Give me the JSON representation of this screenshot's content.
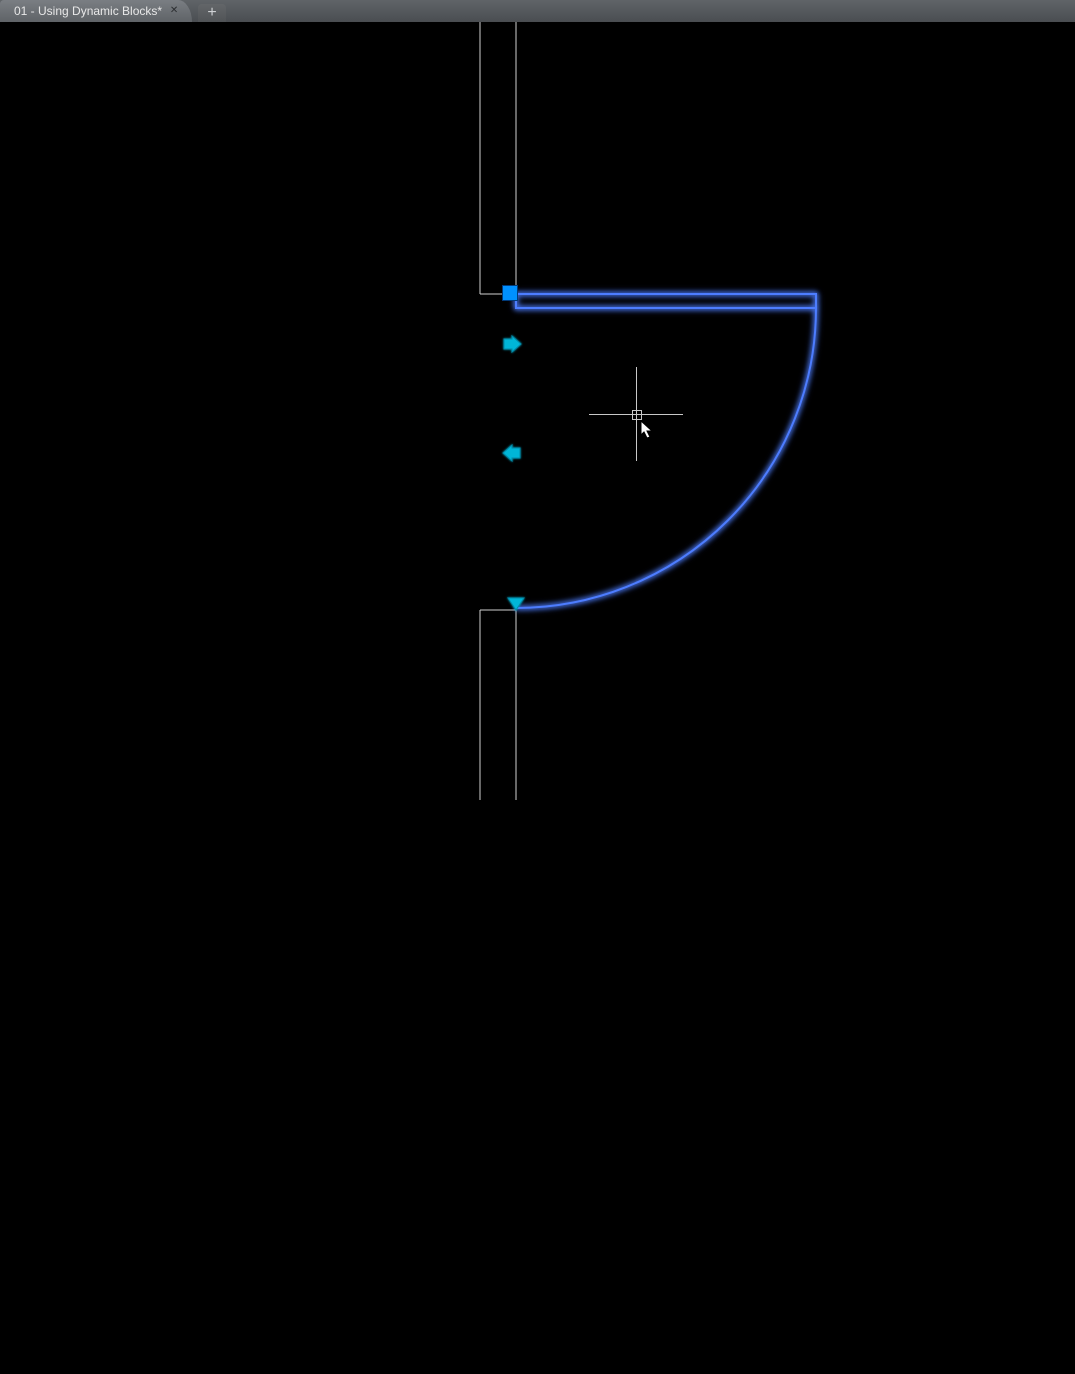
{
  "tabs": {
    "active": {
      "label": "01 - Using Dynamic Blocks*"
    },
    "new_tab_icon": "plus-icon",
    "close_icon": "close-icon"
  },
  "block": {
    "name": "door-dynamic-block",
    "selected": true,
    "grips": {
      "base": {
        "icon": "base-grip",
        "type": "insertion"
      },
      "flip_h": {
        "icon": "arrow-right-grip",
        "type": "flip"
      },
      "lookup": {
        "icon": "arrow-left-grip",
        "type": "lookup"
      },
      "stretch": {
        "icon": "triangle-down-grip",
        "type": "linear"
      }
    }
  },
  "cursor": {
    "icon": "crosshair-cursor"
  },
  "colors": {
    "selection_glow": "#4d7dff",
    "grip_primary": "#0090ff",
    "grip_flip": "#00b6d8",
    "wall": "#d0d0d0",
    "background": "#000000",
    "tabstrip": "#5a5d61"
  }
}
